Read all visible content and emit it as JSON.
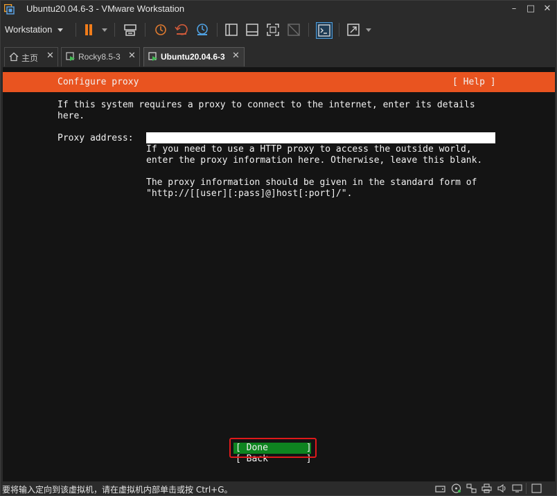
{
  "window": {
    "title": "Ubuntu20.04.6-3 - VMware Workstation",
    "minimize": "–",
    "maximize": "□",
    "close": "✕"
  },
  "toolbar": {
    "menu_label": "Workstation",
    "icons": [
      "pause-icon",
      "send-keys-icon",
      "snapshot-icon",
      "revert-snapshot-icon",
      "manage-snapshots-icon",
      "sidebar-view-icon",
      "single-view-icon",
      "fullscreen-icon",
      "unity-icon",
      "console-view-icon",
      "stretch-icon"
    ]
  },
  "tabs": [
    {
      "label": "主页",
      "icon": "home-icon",
      "close": "✕"
    },
    {
      "label": "Rocky8.5-3",
      "icon": "vm-icon",
      "close": "✕"
    },
    {
      "label": "Ubuntu20.04.6-3",
      "icon": "vm-icon",
      "close": "✕"
    }
  ],
  "installer": {
    "header_title": "Configure proxy",
    "help_label": "[ Help ]",
    "intro": "If this system requires a proxy to connect to the internet, enter its details\nhere.",
    "proxy_label": "Proxy address:",
    "proxy_value": "",
    "help_text_1": "If you need to use a HTTP proxy to access the outside world,\nenter the proxy information here. Otherwise, leave this blank.",
    "help_text_2": "The proxy information should be given in the standard form of\n\"http://[[user][:pass]@]host[:port]/\".",
    "done_label": "[ Done       ]",
    "back_label": "[ Back       ]"
  },
  "statusbar": {
    "message": "要将输入定向到该虚拟机，请在虚拟机内部单击或按 Ctrl+G。",
    "icons": [
      "hard-disk-icon",
      "cd-dvd-icon",
      "network-icon",
      "printer-icon",
      "sound-icon",
      "display-icon",
      "stretch-toggle-icon"
    ]
  },
  "colors": {
    "installer_header": "#e95420",
    "button_focus": "#0e8420",
    "highlight_box": "#e0191b",
    "pause_orange": "#f07c1b"
  }
}
